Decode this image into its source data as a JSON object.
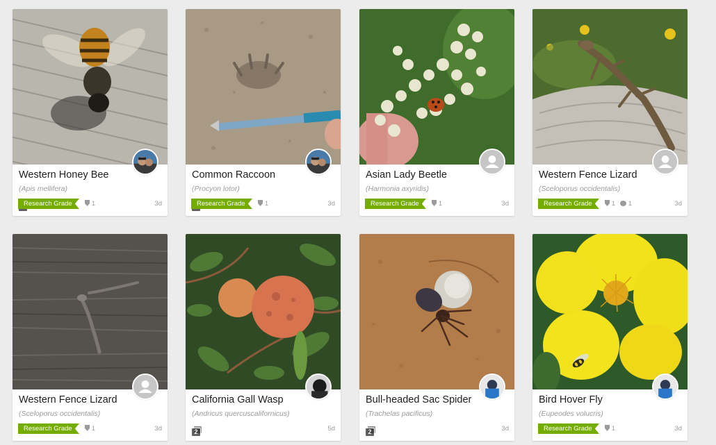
{
  "observations": [
    {
      "common_name": "Western Honey Bee",
      "scientific_name": "(Apis mellifera)",
      "grade": "Research Grade",
      "ids": "1",
      "comments": "",
      "age": "3d",
      "photo_count": "2",
      "avatar": "person"
    },
    {
      "common_name": "Common Raccoon",
      "scientific_name": "(Procyon lotor)",
      "grade": "Research Grade",
      "ids": "1",
      "comments": "",
      "age": "3d",
      "photo_count": "2",
      "avatar": "person"
    },
    {
      "common_name": "Asian Lady Beetle",
      "scientific_name": "(Harmonia axyridis)",
      "grade": "Research Grade",
      "ids": "1",
      "comments": "",
      "age": "3d",
      "photo_count": "",
      "avatar": "default"
    },
    {
      "common_name": "Western Fence Lizard",
      "scientific_name": "(Sceloporus occidentalis)",
      "grade": "Research Grade",
      "ids": "1",
      "comments": "1",
      "age": "3d",
      "photo_count": "",
      "avatar": "default"
    },
    {
      "common_name": "Western Fence Lizard",
      "scientific_name": "(Sceloporus occidentalis)",
      "grade": "Research Grade",
      "ids": "1",
      "comments": "",
      "age": "3d",
      "photo_count": "",
      "avatar": "default"
    },
    {
      "common_name": "California Gall Wasp",
      "scientific_name": "(Andricus quercuscalifornicus)",
      "grade": "",
      "ids": "",
      "comments": "",
      "age": "5d",
      "photo_count": "2",
      "avatar": "person"
    },
    {
      "common_name": "Bull-headed Sac Spider",
      "scientific_name": "(Trachelas pacificus)",
      "grade": "",
      "ids": "",
      "comments": "",
      "age": "3d",
      "photo_count": "2",
      "avatar": "person"
    },
    {
      "common_name": "Bird Hover Fly",
      "scientific_name": "(Eupeodes volucris)",
      "grade": "Research Grade",
      "ids": "1",
      "comments": "",
      "age": "3d",
      "photo_count": "",
      "avatar": "person"
    }
  ],
  "colors": {
    "research_grade": "#74ac00",
    "muted_text": "#9b9b9b",
    "background": "#ececec"
  },
  "icons": {
    "identifications": "shield-icon",
    "comments": "comment-icon",
    "photos": "photo-stack-icon",
    "default_avatar": "user-silhouette-icon"
  }
}
